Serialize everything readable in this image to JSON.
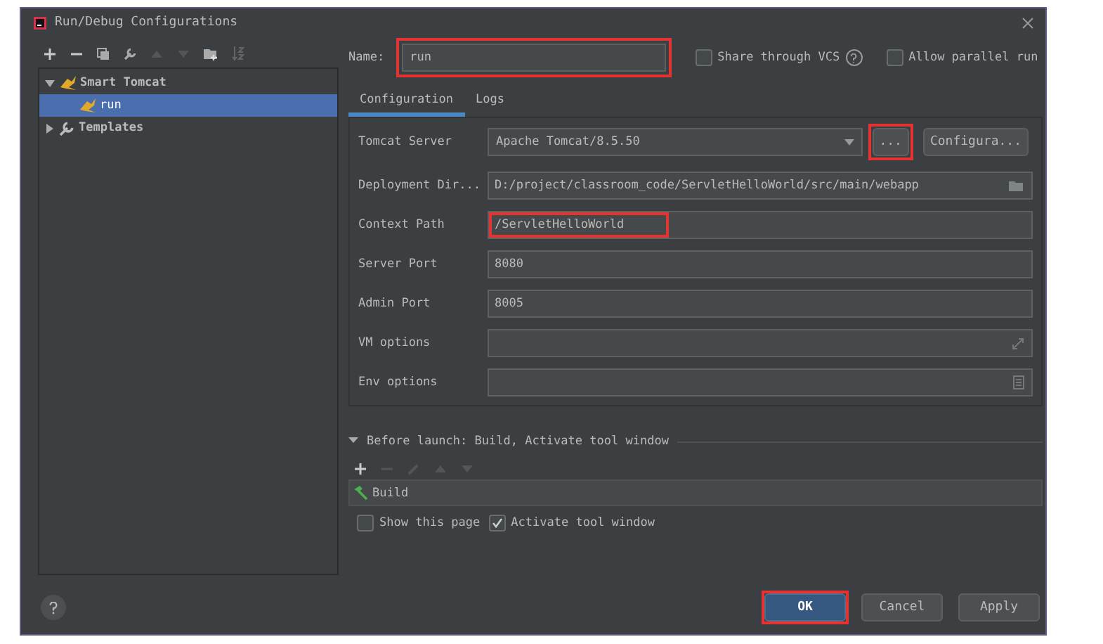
{
  "window": {
    "title": "Run/Debug Configurations"
  },
  "tree": [
    {
      "label": "Smart Tomcat",
      "expanded": true,
      "selected": false,
      "children": [
        {
          "label": "run",
          "selected": true
        }
      ]
    },
    {
      "label": "Templates",
      "expanded": false,
      "selected": false
    }
  ],
  "name": {
    "label": "Name:",
    "value": "run",
    "highlighted": true
  },
  "options": [
    {
      "label": "Share through VCS",
      "checked": false,
      "has_help": true
    },
    {
      "label": "Allow parallel run",
      "checked": false
    }
  ],
  "tabs": [
    {
      "label": "Configuration",
      "selected": true
    },
    {
      "label": "Logs",
      "selected": false
    }
  ],
  "fields": [
    {
      "kind": "dropdown",
      "label": "Tomcat Server",
      "value": "Apache Tomcat/8.5.50",
      "buttons": [
        {
          "label": "...",
          "highlighted": true
        },
        {
          "label": "Configura...",
          "highlighted": false
        }
      ]
    },
    {
      "kind": "folder",
      "label": "Deployment Dir...",
      "value": "D:/project/classroom_code/ServletHelloWorld/src/main/webapp",
      "highlighted": false
    },
    {
      "kind": "text",
      "label": "Context Path",
      "value": "/ServletHelloWorld",
      "highlighted": true
    },
    {
      "kind": "text",
      "label": "Server Port",
      "value": "8080",
      "highlighted": false
    },
    {
      "kind": "text",
      "label": "Admin Port",
      "value": "8005",
      "highlighted": false
    },
    {
      "kind": "expand",
      "label": "VM options"
    },
    {
      "kind": "list",
      "label": "Env options"
    }
  ],
  "before_launch": {
    "title": "Before launch: Build, Activate tool window",
    "expanded": true,
    "tasks": [
      "Build"
    ],
    "options": [
      {
        "label": "Show this page",
        "checked": false
      },
      {
        "label": "Activate tool window",
        "checked": true
      }
    ]
  },
  "buttons": [
    {
      "label": "OK",
      "default": true,
      "highlighted": true
    },
    {
      "label": "Cancel",
      "default": false,
      "highlighted": false
    },
    {
      "label": "Apply",
      "default": false,
      "highlighted": false
    }
  ]
}
